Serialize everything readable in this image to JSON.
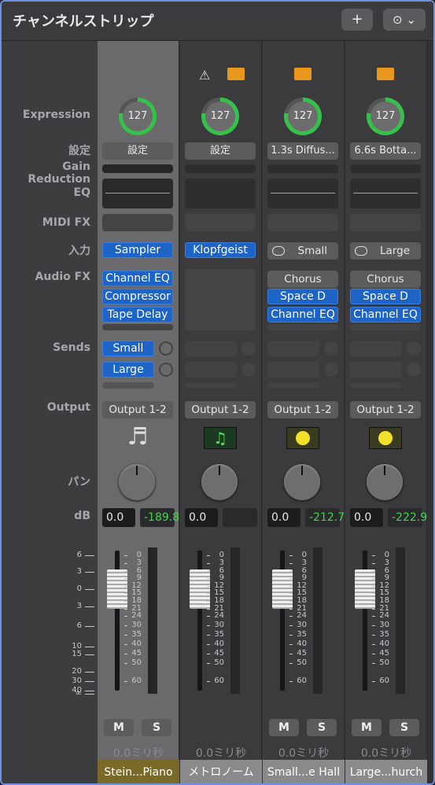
{
  "window": {
    "title": "チャンネルストリップ",
    "add_label": "+",
    "more_label": "⊙ ⌄"
  },
  "labels": {
    "expression": "Expression",
    "settings": "設定",
    "gain_reduction": "Gain Reduction",
    "eq": "EQ",
    "midi_fx": "MIDI FX",
    "input": "入力",
    "audio_fx": "Audio FX",
    "sends": "Sends",
    "output": "Output",
    "pan": "パン",
    "db": "dB"
  },
  "scale": {
    "left": [
      "6",
      "3",
      "0",
      "3",
      "6",
      "10",
      "15",
      "20",
      "30",
      "40",
      "∞"
    ],
    "right": [
      "0",
      "3",
      "6",
      "9",
      "12",
      "15",
      "18",
      "21",
      "24",
      "30",
      "35",
      "40",
      "45",
      "50",
      "60"
    ]
  },
  "strips": [
    {
      "expression": "127",
      "settings": "設定",
      "input": "Sampler",
      "audio_fx": [
        "Channel EQ",
        "Compressor",
        "Tape Delay"
      ],
      "sends": [
        "Small",
        "Large"
      ],
      "output": "Output 1-2",
      "icon": "piano-icon",
      "db_value": "0.0",
      "db_peak": "-189.8",
      "mute": "M",
      "solo": "S",
      "delay": "0.0ミリ秒",
      "name": "Stein...Piano",
      "name_color": "#7a6a2a"
    },
    {
      "expression": "127",
      "settings": "設定",
      "input": "Klopfgeist",
      "audio_fx": [],
      "sends": [],
      "output": "Output 1-2",
      "icon": "music-note-icon",
      "db_value": "0.0",
      "db_peak": "",
      "mute": "",
      "solo": "",
      "delay": "0.0ミリ秒",
      "name": "メトロノーム",
      "name_color": "#8a8a8c"
    },
    {
      "expression": "127",
      "settings": "1.3s Diffus...",
      "input": "Small",
      "audio_fx": [
        "Chorus",
        "Space D",
        "Channel EQ"
      ],
      "sends": [],
      "output": "Output 1-2",
      "icon": "aux-icon",
      "db_value": "0.0",
      "db_peak": "-212.7",
      "mute": "M",
      "solo": "S",
      "delay": "0.0ミリ秒",
      "name": "Small...e Hall",
      "name_color": "#8a8a8c"
    },
    {
      "expression": "127",
      "settings": "6.6s Botta...",
      "input": "Large",
      "audio_fx": [
        "Chorus",
        "Space D",
        "Channel EQ"
      ],
      "sends": [],
      "output": "Output 1-2",
      "icon": "aux-icon",
      "db_value": "0.0",
      "db_peak": "-222.9",
      "mute": "M",
      "solo": "S",
      "delay": "0.0ミリ秒",
      "name": "Large...hurch",
      "name_color": "#8a8a8c"
    }
  ]
}
